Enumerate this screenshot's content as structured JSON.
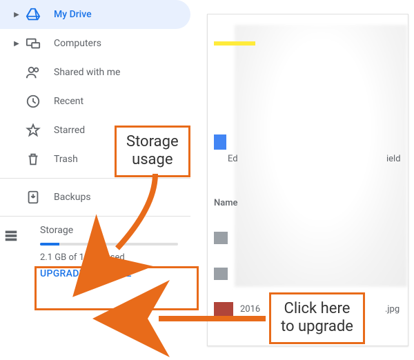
{
  "sidebar": {
    "items": [
      {
        "label": "My Drive"
      },
      {
        "label": "Computers"
      },
      {
        "label": "Shared with me"
      },
      {
        "label": "Recent"
      },
      {
        "label": "Starred"
      },
      {
        "label": "Trash"
      },
      {
        "label": "Backups"
      }
    ]
  },
  "storage": {
    "title": "Storage",
    "used_text": "2.1 GB of 15 GB used",
    "upgrade_label": "UPGRADE STORAGE"
  },
  "callouts": {
    "usage": "Storage\nusage",
    "upgrade": "Click here\nto upgrade"
  },
  "content": {
    "edited_prefix": "Ed",
    "field_suffix": "ield",
    "name_header": "Name",
    "year_fragment": "2016",
    "ext_fragment": ".jpg"
  }
}
